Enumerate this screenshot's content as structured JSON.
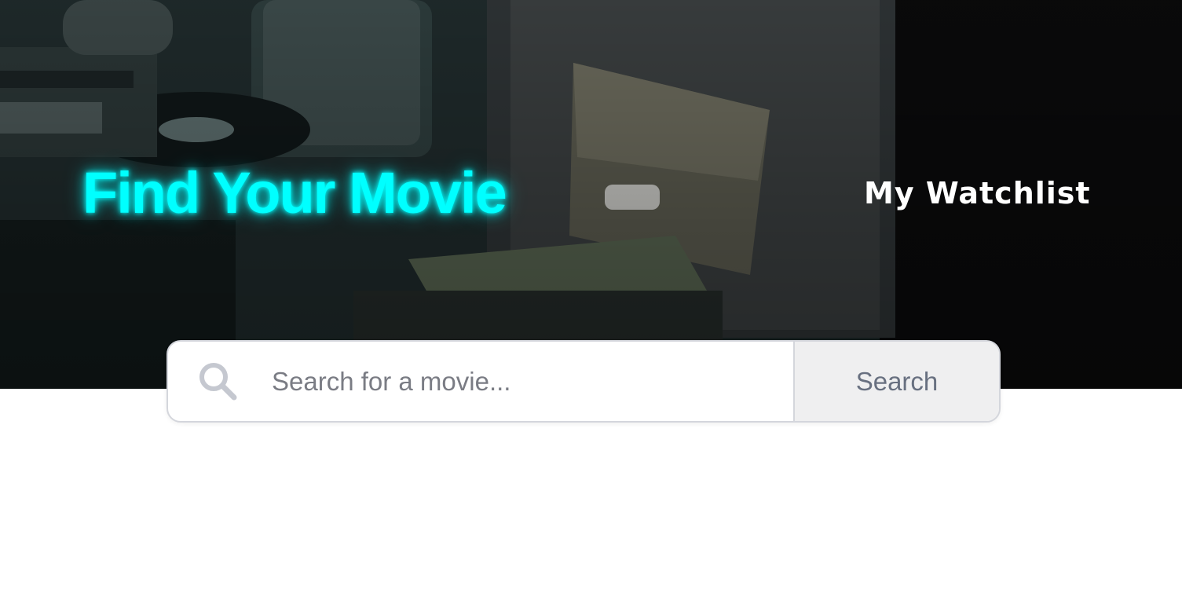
{
  "header": {
    "title": "Find Your Movie",
    "nav_link": "My Watchlist"
  },
  "search": {
    "placeholder": "Search for a movie...",
    "button_label": "Search"
  },
  "colors": {
    "title_glow": "#00ffff",
    "nav_text": "#ffffff",
    "search_icon": "#c5c8d0"
  },
  "icons": {
    "search": "search-icon"
  }
}
